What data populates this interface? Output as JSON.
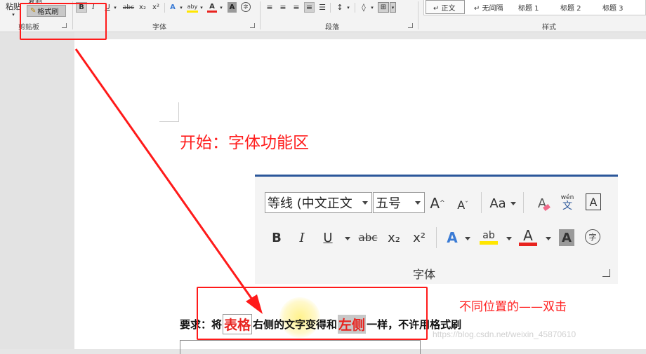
{
  "ribbon": {
    "clipboard": {
      "paste_label": "粘贴",
      "copy_label": "复制",
      "format_painter_label": "格式刷",
      "group_label": "剪贴板"
    },
    "font": {
      "group_label": "字体",
      "bold": "B",
      "italic": "I",
      "underline": "U",
      "strike": "abc",
      "sub": "x₂",
      "sup": "x²",
      "text_effect": "A",
      "highlight": "aby",
      "font_color": "A",
      "shading": "A",
      "enclose": "字"
    },
    "paragraph": {
      "group_label": "段落"
    },
    "styles": {
      "group_label": "样式",
      "items": [
        "↵ 正文",
        "↵ 无间隔",
        "标题 1",
        "标题 2",
        "标题 3"
      ]
    }
  },
  "document": {
    "heading": "开始：字体功能区",
    "zoom_panel": {
      "font_name": "等线 (中文正文",
      "font_size": "五号",
      "grow": "A",
      "shrink": "A",
      "change_case": "Aa",
      "clear_format": "A",
      "phonetic_top": "wén",
      "phonetic_bottom": "文",
      "border_char": "A",
      "bold": "B",
      "italic": "I",
      "underline": "U",
      "strike": "abc",
      "sub": "x₂",
      "sup": "x²",
      "text_effect": "A",
      "highlight": "ab",
      "font_color": "A",
      "shading": "A",
      "enclose": "字",
      "group_label": "字体"
    },
    "requirement": {
      "prefix": "要求：将",
      "word1": "表格",
      "middle": "右侧的文字变得和",
      "word2": "左侧",
      "suffix": "一样，不许用格式刷"
    },
    "note": "不同位置的——双击",
    "watermark": "https://blog.csdn.net/weixin_45870610"
  },
  "colors": {
    "annotation_red": "#ff1a1a",
    "accent_blue": "#2b579a",
    "highlight_yellow": "#ffe600",
    "font_red": "#e8231f"
  }
}
